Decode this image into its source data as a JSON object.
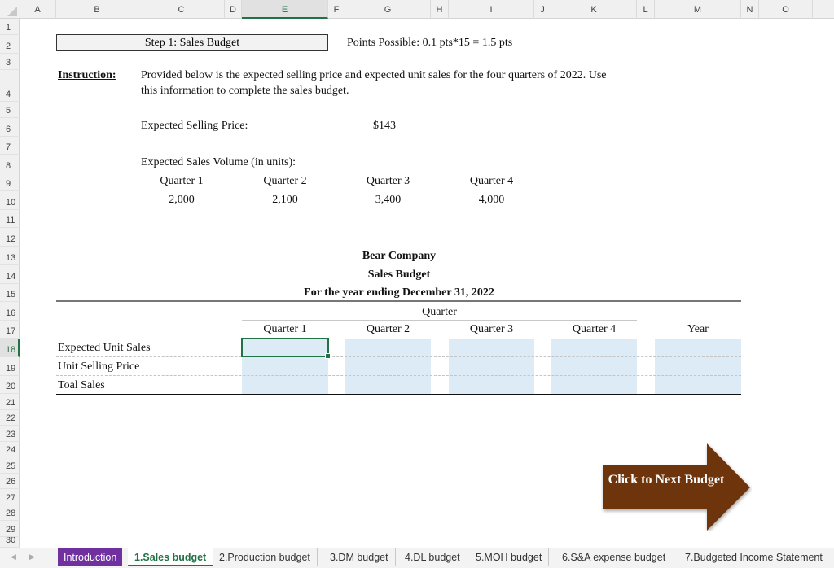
{
  "columns": [
    "A",
    "B",
    "C",
    "D",
    "E",
    "F",
    "G",
    "H",
    "I",
    "J",
    "K",
    "L",
    "M",
    "N",
    "O"
  ],
  "selected_column": "E",
  "rows": [
    "1",
    "2",
    "3",
    "4",
    "5",
    "6",
    "7",
    "8",
    "9",
    "10",
    "11",
    "12",
    "13",
    "14",
    "15",
    "16",
    "17",
    "18",
    "19",
    "20",
    "21",
    "22",
    "23",
    "24",
    "25",
    "26",
    "27",
    "28",
    "29",
    "30"
  ],
  "selected_row": "18",
  "header": {
    "title": "Step 1: Sales Budget",
    "points": "Points Possible: 0.1 pts*15 = 1.5 pts"
  },
  "instruction": {
    "label": "Instruction:",
    "line1": "Provided below is the expected selling price and expected unit sales for the four quarters of 2022. Use",
    "line2": "this information to complete the sales budget."
  },
  "selling_price": {
    "label": "Expected Selling Price:",
    "value": "$143"
  },
  "sales_volume": {
    "label": "Expected Sales Volume (in units):",
    "quarters": [
      "Quarter 1",
      "Quarter 2",
      "Quarter 3",
      "Quarter 4"
    ],
    "values": [
      "2,000",
      "2,100",
      "3,400",
      "4,000"
    ]
  },
  "budget": {
    "company": "Bear Company",
    "title": "Sales Budget",
    "period": "For the year ending December 31, 2022",
    "quarter_group": "Quarter",
    "columns": [
      "Quarter 1",
      "Quarter 2",
      "Quarter 3",
      "Quarter 4",
      "Year"
    ],
    "rows": [
      "Expected Unit Sales",
      "Unit Selling Price",
      "Toal Sales"
    ]
  },
  "next_button": {
    "label": "Click to Next Budget",
    "color": "#6e3510"
  },
  "sheet_tabs": [
    {
      "label": "Introduction",
      "state": "purple"
    },
    {
      "label": "1.Sales budget",
      "state": "active"
    },
    {
      "label": "2.Production budget",
      "state": "normal"
    },
    {
      "label": "3.DM budget",
      "state": "normal"
    },
    {
      "label": "4.DL budget",
      "state": "normal"
    },
    {
      "label": "5.MOH budget",
      "state": "normal"
    },
    {
      "label": "6.S&A expense budget",
      "state": "normal"
    },
    {
      "label": "7.Budgeted Income Statement",
      "state": "normal"
    }
  ],
  "colors": {
    "excel_green": "#217346",
    "input_fill": "#ddebf7",
    "intro_tab": "#7030a0"
  }
}
